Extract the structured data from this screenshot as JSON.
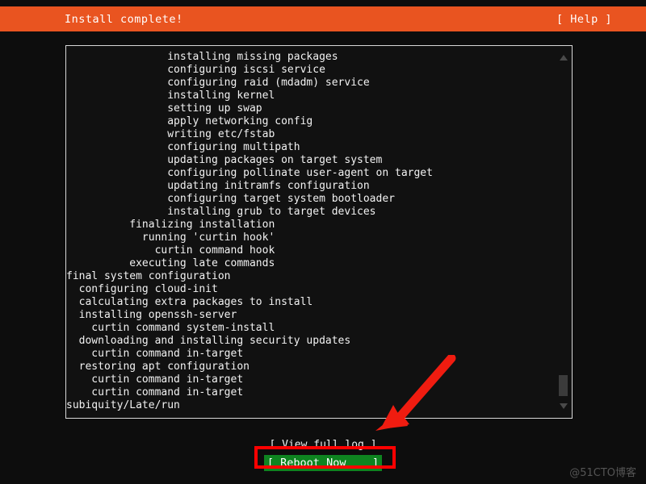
{
  "header": {
    "title": "Install complete!",
    "help_label": "[ Help ]",
    "background_color": "#e95420",
    "text_color": "#ffffff"
  },
  "log_panel": {
    "lines": [
      "                installing missing packages",
      "                configuring iscsi service",
      "                configuring raid (mdadm) service",
      "                installing kernel",
      "                setting up swap",
      "                apply networking config",
      "                writing etc/fstab",
      "                configuring multipath",
      "                updating packages on target system",
      "                configuring pollinate user-agent on target",
      "                updating initramfs configuration",
      "                configuring target system bootloader",
      "                installing grub to target devices",
      "          finalizing installation",
      "            running 'curtin hook'",
      "              curtin command hook",
      "          executing late commands",
      "final system configuration",
      "  configuring cloud-init",
      "  calculating extra packages to install",
      "  installing openssh-server",
      "    curtin command system-install",
      "  downloading and installing security updates",
      "    curtin command in-target",
      "  restoring apt configuration",
      "    curtin command in-target",
      "    curtin command in-target",
      "subiquity/Late/run"
    ],
    "scrollbar": {
      "up_arrow": "scroll-up-arrow",
      "down_arrow": "scroll-down-arrow",
      "thumb": "scroll-thumb"
    }
  },
  "footer": {
    "view_log_label": "[ View full log ]",
    "reboot_prefix": "[ ",
    "reboot_accel": "R",
    "reboot_rest": "eboot Now",
    "reboot_suffix": "    ]",
    "reboot_background_color": "#0e8420"
  },
  "annotations": {
    "highlight_color": "#ff0000",
    "rectangle_target": "reboot-now-button",
    "arrow_target": "reboot-now-button"
  },
  "watermark": {
    "text": "@51CTO博客"
  }
}
